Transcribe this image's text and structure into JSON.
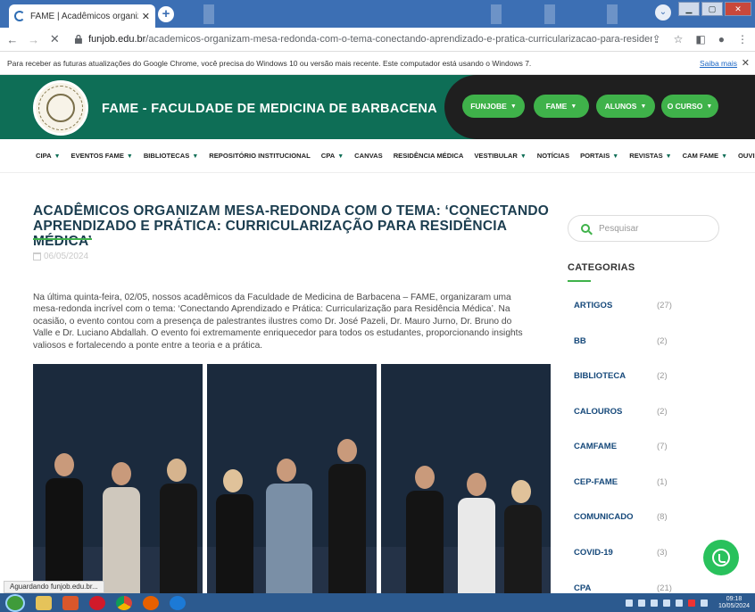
{
  "browser": {
    "tab_title": "FAME | Acadêmicos organizam m",
    "url_host": "funjob.edu.br",
    "url_path": "/academicos-organizam-mesa-redonda-com-o-tema-conectando-aprendizado-e-pratica-curricularizacao-para-residencia-medica/",
    "infobar_text": "Para receber as futuras atualizações do Google Chrome, você precisa do Windows 10 ou versão mais recente. Este computador está usando o Windows 7.",
    "infobar_link": "Saiba mais",
    "status_text": "Aguardando funjob.edu.br..."
  },
  "site": {
    "title": "FAME - FACULDADE DE MEDICINA DE BARBACENA",
    "header_buttons": [
      "FUNJOBE",
      "FAME",
      "ALUNOS",
      "O CURSO"
    ],
    "menu": [
      {
        "label": "CIPA",
        "dropdown": true
      },
      {
        "label": "EVENTOS FAME",
        "dropdown": true
      },
      {
        "label": "BIBLIOTECAS",
        "dropdown": true
      },
      {
        "label": "REPOSITÓRIO INSTITUCIONAL",
        "dropdown": false
      },
      {
        "label": "CPA",
        "dropdown": true
      },
      {
        "label": "CANVAS",
        "dropdown": false
      },
      {
        "label": "RESIDÊNCIA MÉDICA",
        "dropdown": false
      },
      {
        "label": "VESTIBULAR",
        "dropdown": true
      },
      {
        "label": "NOTÍCIAS",
        "dropdown": false
      },
      {
        "label": "PORTAIS",
        "dropdown": true
      },
      {
        "label": "REVISTAS",
        "dropdown": true
      },
      {
        "label": "CAM FAME",
        "dropdown": true
      },
      {
        "label": "OUVIDORIA",
        "dropdown": false
      }
    ]
  },
  "article": {
    "title": "ACADÊMICOS ORGANIZAM MESA-REDONDA COM O TEMA: ‘CONECTANDO APRENDIZADO E PRÁTICA: CURRICULARIZAÇÃO PARA RESIDÊNCIA MÉDICA’",
    "date": "06/05/2024",
    "body": "Na última quinta-feira, 02/05, nossos acadêmicos da Faculdade de Medicina de Barbacena – FAME, organizaram uma mesa-redonda incrível com o tema: ‘Conectando Aprendizado e Prática: Curricularização para Residência Médica’. Na ocasião, o evento contou com a presença de palestrantes ilustres como Dr. José Pazeli, Dr. Mauro Jurno, Dr. Bruno do Valle e Dr. Luciano Abdallah. O evento foi extremamente enriquecedor para todos os estudantes, proporcionando insights valiosos e fortalecendo a ponte entre a teoria e a prática."
  },
  "sidebar": {
    "search_placeholder": "Pesquisar",
    "categories_heading": "CATEGORIAS",
    "categories": [
      {
        "name": "ARTIGOS",
        "count": "(27)"
      },
      {
        "name": "BB",
        "count": "(2)"
      },
      {
        "name": "BIBLIOTECA",
        "count": "(2)"
      },
      {
        "name": "CALOUROS",
        "count": "(2)"
      },
      {
        "name": "CAMFAME",
        "count": "(7)"
      },
      {
        "name": "CEP-FAME",
        "count": "(1)"
      },
      {
        "name": "COMUNICADO",
        "count": "(8)"
      },
      {
        "name": "COVID-19",
        "count": "(3)"
      },
      {
        "name": "CPA",
        "count": "(21)"
      }
    ]
  },
  "taskbar": {
    "time": "09:18",
    "date": "10/05/2024"
  },
  "colors": {
    "brand_green": "#0e6e56",
    "pill_green": "#3fb24a",
    "title_navy": "#1b3d4f",
    "category_blue": "#15487a"
  }
}
